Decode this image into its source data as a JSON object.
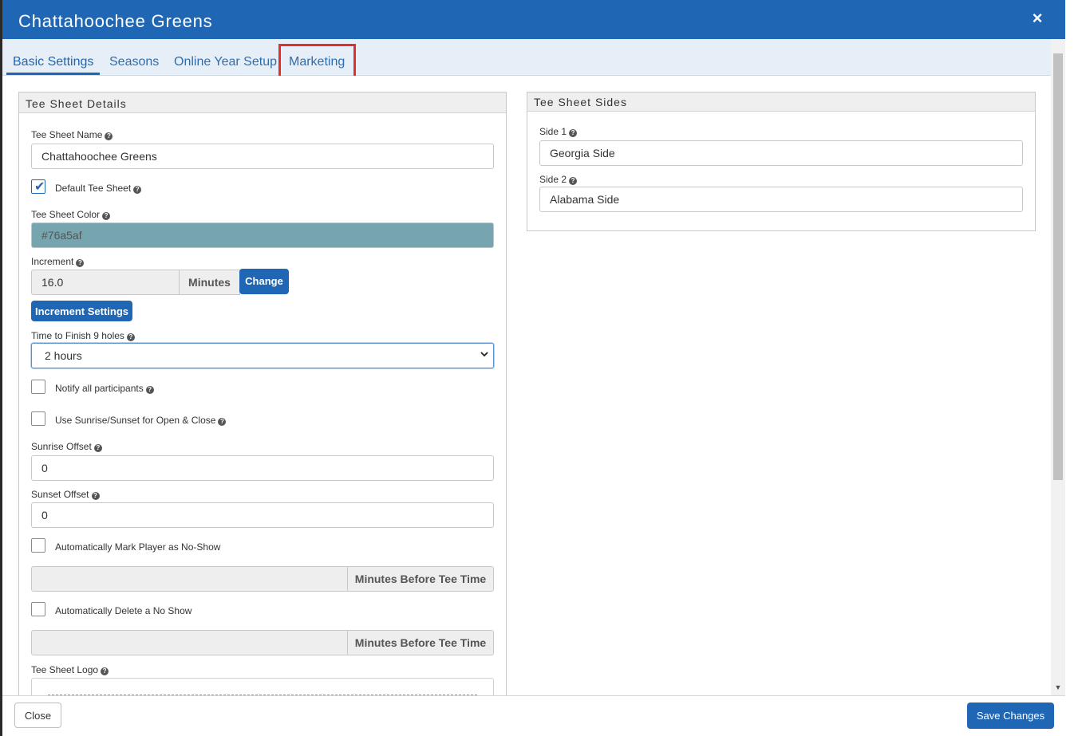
{
  "header": {
    "title": "Chattahoochee Greens",
    "close_icon": "×"
  },
  "tabs": [
    {
      "label": "Basic Settings",
      "active": true
    },
    {
      "label": "Seasons",
      "active": false
    },
    {
      "label": "Online Year Setup",
      "active": false
    },
    {
      "label": "Marketing",
      "active": false,
      "highlighted": true
    }
  ],
  "details_panel": {
    "title": "Tee Sheet Details",
    "name_label": "Tee Sheet Name",
    "name_value": "Chattahoochee Greens",
    "default_label": "Default Tee Sheet",
    "default_checked": true,
    "color_label": "Tee Sheet Color",
    "color_value": "#76a5af",
    "increment_label": "Increment",
    "increment_value": "16.0",
    "increment_unit": "Minutes",
    "change_button": "Change",
    "increment_settings_button": "Increment Settings",
    "finish_label": "Time to Finish 9 holes",
    "finish_value": "2 hours",
    "notify_label": "Notify all participants",
    "sunrise_sunset_label": "Use Sunrise/Sunset for Open & Close",
    "sunrise_offset_label": "Sunrise Offset",
    "sunrise_offset_value": "0",
    "sunset_offset_label": "Sunset Offset",
    "sunset_offset_value": "0",
    "no_show_label": "Automatically Mark Player as No-Show",
    "no_show_addon": "Minutes Before Tee Time",
    "delete_no_show_label": "Automatically Delete a No Show",
    "delete_no_show_addon": "Minutes Before Tee Time",
    "logo_label": "Tee Sheet Logo"
  },
  "sides_panel": {
    "title": "Tee Sheet Sides",
    "side1_label": "Side 1",
    "side1_value": "Georgia Side",
    "side2_label": "Side 2",
    "side2_value": "Alabama Side"
  },
  "footer": {
    "close_label": "Close",
    "save_label": "Save Changes"
  },
  "colors": {
    "primary": "#1f66b5",
    "tee_sheet_color": "#76a5af",
    "highlight": "#e0302a"
  }
}
